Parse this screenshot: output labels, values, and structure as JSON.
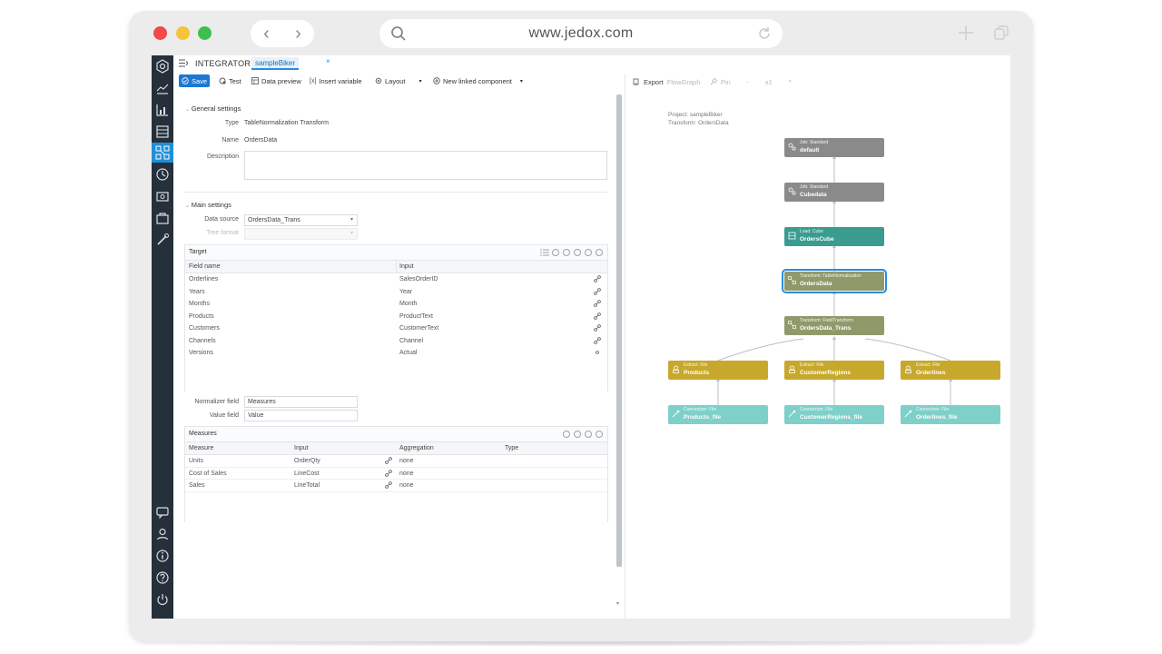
{
  "browser": {
    "url": "www.jedox.com",
    "traffic_colors": [
      "#f04a4a",
      "#f5c43a",
      "#3dbf4f"
    ]
  },
  "app": {
    "title": "INTEGRATOR",
    "tab_label": "sampleBiker",
    "tab_close": "×",
    "accent": "#1e78d2"
  },
  "toolbar": {
    "save": "Save",
    "test": "Test",
    "data_preview": "Data preview",
    "insert_variable": "Insert variable",
    "layout": "Layout",
    "new_linked": "New linked component"
  },
  "general": {
    "heading": "General settings",
    "type_label": "Type",
    "type_value": "TableNormalization Transform",
    "name_label": "Name",
    "name_value": "OrdersData",
    "description_label": "Description",
    "description_value": ""
  },
  "main": {
    "heading": "Main settings",
    "data_source_label": "Data source",
    "data_source_value": "OrdersData_Trans",
    "tree_format_label": "Tree format"
  },
  "target": {
    "heading": "Target",
    "columns": [
      "Field name",
      "Input"
    ],
    "rows": [
      {
        "field": "Orderlines",
        "input": "SalesOrderID"
      },
      {
        "field": "Years",
        "input": "Year"
      },
      {
        "field": "Months",
        "input": "Month"
      },
      {
        "field": "Products",
        "input": "ProductText"
      },
      {
        "field": "Customers",
        "input": "CustomerText"
      },
      {
        "field": "Channels",
        "input": "Channel"
      },
      {
        "field": "Versions",
        "input": "Actual"
      }
    ]
  },
  "normalizer": {
    "normalizer_label": "Normalizer field",
    "normalizer_value": "Measures",
    "value_label": "Value field",
    "value_value": "Value"
  },
  "measures": {
    "heading": "Measures",
    "columns": [
      "Measure",
      "Input",
      "Aggregation",
      "Type"
    ],
    "rows": [
      {
        "measure": "Units",
        "input": "OrderQty",
        "aggregation": "none",
        "type": ""
      },
      {
        "measure": "Cost of Sales",
        "input": "LineCost",
        "aggregation": "none",
        "type": ""
      },
      {
        "measure": "Sales",
        "input": "LineTotal",
        "aggregation": "none",
        "type": ""
      }
    ]
  },
  "flow": {
    "export": "Export",
    "flowgraph": "FlowGraph",
    "pin": "Pin",
    "minus": "-",
    "zoom": "x1",
    "project": "Project: sampleBiker",
    "transform": "Transform: OrdersData",
    "colors": {
      "job": "#8a8a8a",
      "load": "#3a9b8f",
      "transform": "#8f9a6b",
      "extract": "#c7a82c",
      "connection": "#7ed0c9",
      "selected": "#2b8be0"
    },
    "nodes": [
      {
        "type": "Job: Standard",
        "name": "default",
        "kind": "job"
      },
      {
        "type": "Job: Standard",
        "name": "Cubedata",
        "kind": "job"
      },
      {
        "type": "Load: Cube",
        "name": "OrdersCube",
        "kind": "load"
      },
      {
        "type": "Transform: TableNormalization",
        "name": "OrdersData",
        "kind": "transform"
      },
      {
        "type": "Transform: FieldTransform",
        "name": "OrdersData_Trans",
        "kind": "transform"
      },
      {
        "type": "Extract: File",
        "name": "Products",
        "kind": "extract"
      },
      {
        "type": "Extract: File",
        "name": "CustomerRegions",
        "kind": "extract"
      },
      {
        "type": "Extract: File",
        "name": "Orderlines",
        "kind": "extract"
      },
      {
        "type": "Connection: File",
        "name": "Products_file",
        "kind": "connection"
      },
      {
        "type": "Connection: File",
        "name": "CustomerRegions_file",
        "kind": "connection"
      },
      {
        "type": "Connection: File",
        "name": "Orderlines_file",
        "kind": "connection"
      }
    ]
  }
}
